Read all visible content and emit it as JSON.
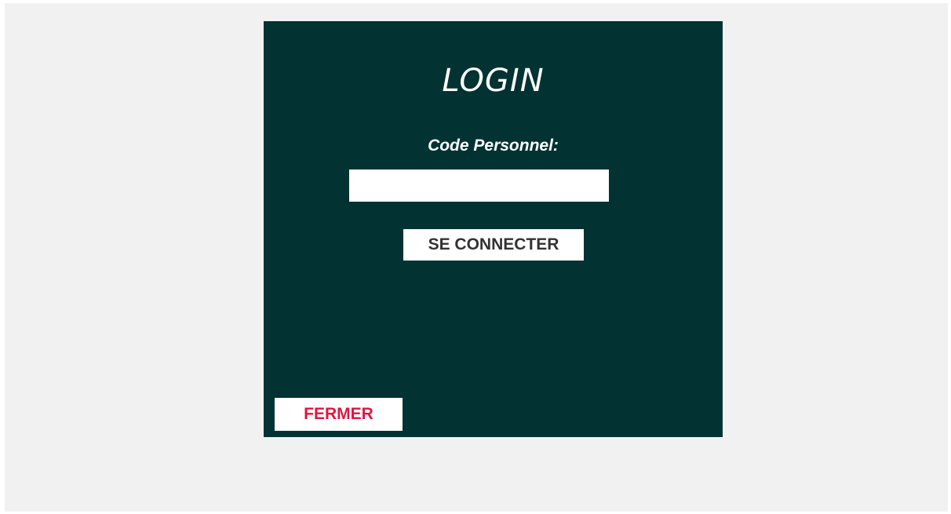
{
  "login": {
    "title": "LOGIN",
    "code_label": "Code Personnel:",
    "code_value": "",
    "connect_label": "SE CONNECTER",
    "close_label": "FERMER"
  },
  "colors": {
    "page_background": "#f1f1f1",
    "panel_background": "#033233",
    "close_text": "#e0163f",
    "button_text": "#333333"
  }
}
